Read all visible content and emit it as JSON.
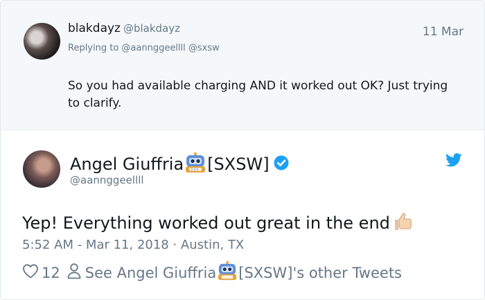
{
  "parent_tweet": {
    "name": "blakdayz",
    "handle": "@blakdayz",
    "replying_to": "Replying to @aannggeellll @sxsw",
    "date": "11 Mar",
    "text": "So you had available charging AND it worked out OK? Just trying to clarify."
  },
  "main_tweet": {
    "name": "Angel Giuffria",
    "name_suffix": "[SXSW]",
    "handle": "@aannggeellll",
    "text": "Yep! Everything worked out great in the end",
    "meta": "5:52 AM - Mar 11, 2018 · Austin, TX",
    "likes": "12",
    "other_tweets_prefix": "See Angel Giuffria",
    "other_tweets_suffix": "[SXSW]'s other Tweets"
  },
  "colors": {
    "text": "#14171a",
    "muted": "#657786",
    "brand_blue": "#1da1f2",
    "parent_bg": "#f5f8fa"
  },
  "icons": {
    "robot": "robot-emoji",
    "verified": "verified-badge",
    "twitter": "twitter-bird",
    "thumb": "thumbs-up-emoji",
    "heart": "heart-outline",
    "person": "person-outline"
  }
}
